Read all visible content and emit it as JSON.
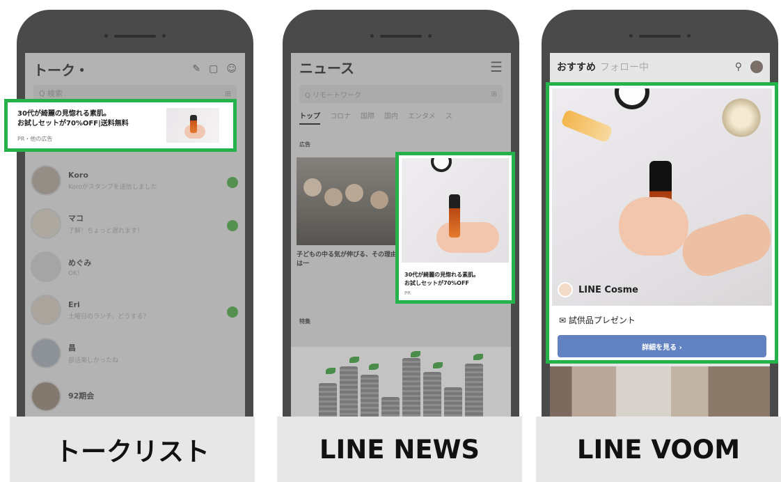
{
  "captions": [
    "トークリスト",
    "LINE NEWS",
    "LINE VOOM"
  ],
  "talk": {
    "title": "トーク・",
    "header_icons": [
      "compose-icon",
      "chat-icon",
      "add-friend-icon"
    ],
    "search_placeholder": "Q 検索",
    "ad": {
      "line1": "30代が綺麗の見惚れる素肌。",
      "line2": "お試しセットが70%OFF|送料無料",
      "sponsor": "PR・他の広告"
    },
    "chats": [
      {
        "name": "Koro",
        "message": "Koroがスタンプを送信しました",
        "time": "",
        "unread": true
      },
      {
        "name": "マコ",
        "message": "了解！ちょっと遅れます！",
        "time": "",
        "unread": true
      },
      {
        "name": "めぐみ",
        "message": "OK!",
        "time": "",
        "unread": false
      },
      {
        "name": "Eri",
        "message": "土曜日のランチ、どうする？",
        "time": "",
        "unread": true
      },
      {
        "name": "昌",
        "message": "部活楽しかったね",
        "time": "",
        "unread": false
      },
      {
        "name": "92期会",
        "message": "",
        "time": "",
        "unread": false
      }
    ]
  },
  "news": {
    "title": "ニュース",
    "search_placeholder": "Q リモートワーク",
    "tabs": [
      "トップ",
      "コロナ",
      "国際",
      "国内",
      "エンタメ",
      "ス"
    ],
    "label_ad": "広告",
    "label_feature": "特集",
    "article_title": "子どもの中る気が伸びる、その理由とは一",
    "article_source": "",
    "ad": {
      "line1": "30代が綺麗の見惚れる素肌。",
      "line2": "お試しセットが70%OFF",
      "sponsor": "PR"
    }
  },
  "voom": {
    "tab_active": "おすすめ",
    "tab_inactive": "フォロー中",
    "brand": "LINE Cosme",
    "promo": "✉ 試供品プレゼント",
    "cta": "詳細を見る ›"
  },
  "colors": {
    "highlight": "#26b24a",
    "cta": "#6282c2",
    "unread": "#4aa043"
  }
}
